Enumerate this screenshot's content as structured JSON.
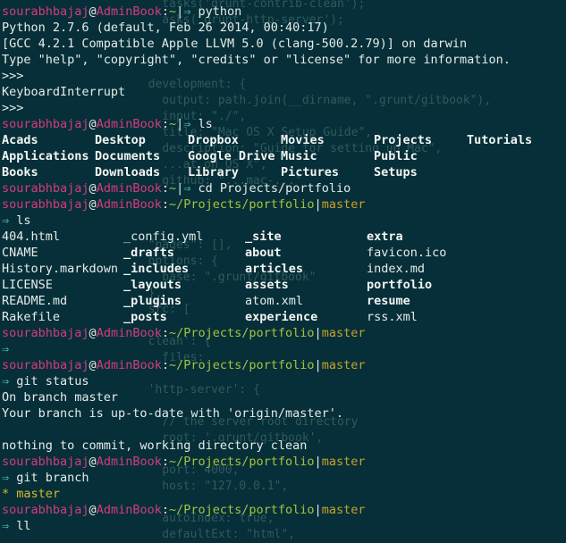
{
  "ghost_code": [
    "    tasks('grunt-contrib-clean');",
    "    asks('grunt-http-server');",
    "",
    "",
    "",
    "  development: {",
    "    output: path.join(__dirname, \".grunt/gitbook\"),",
    "    input: \"./\",",
    "    title: \"Mac OS X Setup Guide\",",
    "    description: \"Guide for setting up Mac\",",
    "    ...at on OS X\",",
    "    github: \"...mac-...\"",
    "",
    "",
    "",
    "  \"pages\": [],",
    "  options: {",
    "    base: \".grunt/gitbook\"",
    "  },",
    "  src: [",
    "",
    "  clean': {",
    "    files:",
    "",
    "  'http-server': {",
    "",
    "    // the server root directory",
    "    root: '.grunt/gitbook',",
    "",
    "    port: 4000,",
    "    host: \"127.0.0.1\",",
    "",
    "    autoIndex: true,",
    "    defaultExt: \"html\","
  ],
  "prompt": {
    "user": "sourabhbajaj",
    "at": "@",
    "host": "AdminBook",
    "colon": ":",
    "home": "~",
    "repo_path": "~/Projects/portfolio",
    "bar": "|",
    "branch": "master",
    "arrow": "⇒"
  },
  "cmds": {
    "python": "python",
    "ls": "ls",
    "cd": "cd Projects/portfolio",
    "git_status": "git status",
    "git_branch": "git branch",
    "ll": "ll"
  },
  "python_out": {
    "banner1": "Python 2.7.6 (default, Feb 26 2014, 00:40:17)",
    "banner2": "[GCC 4.2.1 Compatible Apple LLVM 5.0 (clang-500.2.79)] on darwin",
    "banner3": "Type \"help\", \"copyright\", \"credits\" or \"license\" for more information.",
    "ps1": ">>>",
    "interrupt": "KeyboardInterrupt"
  },
  "home_ls": [
    [
      "Acads",
      "Desktop",
      "Dropbox",
      "Movies",
      "Projects",
      "Tutorials"
    ],
    [
      "Applications",
      "Documents",
      "Google Drive",
      "Music",
      "Public",
      ""
    ],
    [
      "Books",
      "Downloads",
      "Library",
      "Pictures",
      "Setups",
      ""
    ]
  ],
  "portfolio_ls": [
    [
      {
        "t": "404.html",
        "b": false
      },
      {
        "t": "_config.yml",
        "b": false
      },
      {
        "t": "_site",
        "b": true
      },
      {
        "t": "extra",
        "b": true
      }
    ],
    [
      {
        "t": "CNAME",
        "b": false
      },
      {
        "t": "_drafts",
        "b": true
      },
      {
        "t": "about",
        "b": true
      },
      {
        "t": "favicon.ico",
        "b": false
      }
    ],
    [
      {
        "t": "History.markdown",
        "b": false
      },
      {
        "t": "_includes",
        "b": true
      },
      {
        "t": "articles",
        "b": true
      },
      {
        "t": "index.md",
        "b": false
      }
    ],
    [
      {
        "t": "LICENSE",
        "b": false
      },
      {
        "t": "_layouts",
        "b": true
      },
      {
        "t": "assets",
        "b": true
      },
      {
        "t": "portfolio",
        "b": true
      }
    ],
    [
      {
        "t": "README.md",
        "b": false
      },
      {
        "t": "_plugins",
        "b": true
      },
      {
        "t": "atom.xml",
        "b": false
      },
      {
        "t": "resume",
        "b": true
      }
    ],
    [
      {
        "t": "Rakefile",
        "b": false
      },
      {
        "t": "_posts",
        "b": true
      },
      {
        "t": "experience",
        "b": true
      },
      {
        "t": "rss.xml",
        "b": false
      }
    ]
  ],
  "git_status_out": {
    "l1": "On branch master",
    "l2": "Your branch is up-to-date with 'origin/master'.",
    "l3": "nothing to commit, working directory clean"
  },
  "git_branch_out": {
    "star": "*",
    "name": "master"
  },
  "colors": {
    "background": "#062f39",
    "user": "#d33c7e",
    "path": "#a7c23e",
    "branch": "#c9a227",
    "arrow": "#4bc6c7",
    "text": "#e6ece8"
  }
}
